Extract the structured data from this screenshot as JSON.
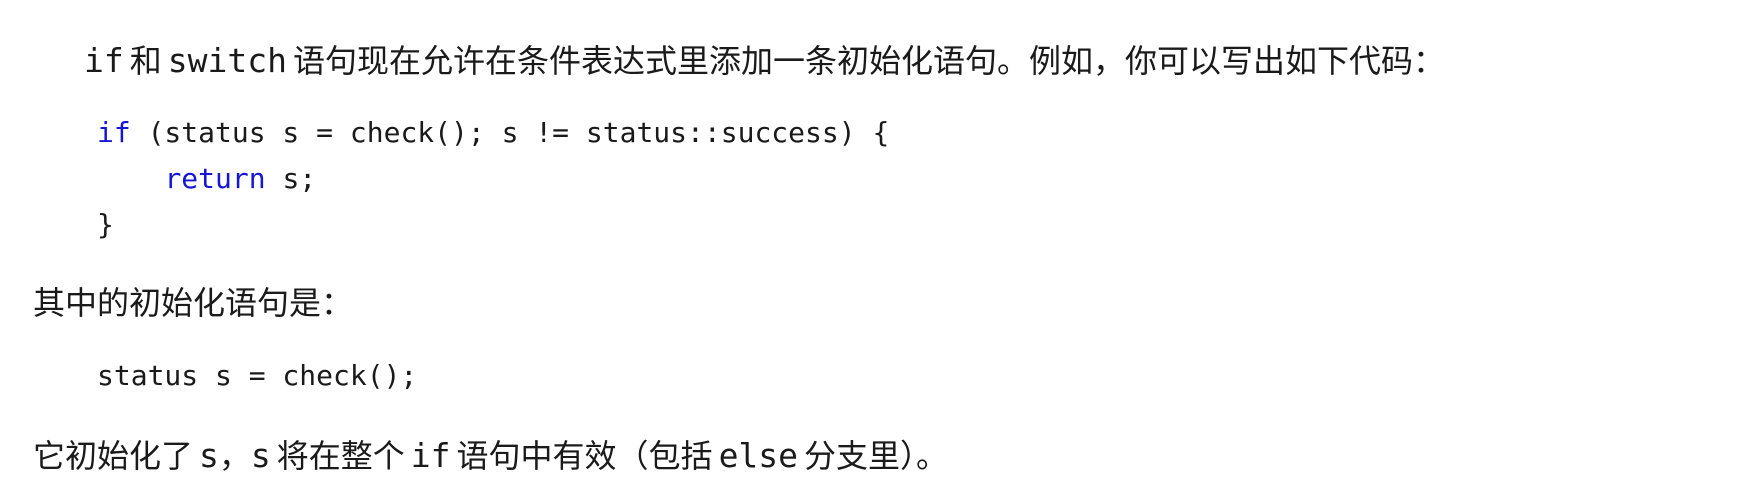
{
  "intro": {
    "kw_if": "if",
    "text_he": "和",
    "kw_switch": "switch",
    "text_rest": "语句现在允许在条件表达式里添加一条初始化语句。例如，你可以写出如下代码："
  },
  "code_block": {
    "line1_kw": "if",
    "line1_rest": " (status s = check(); s != status::success) {",
    "line2_indent": "    ",
    "line2_kw": "return",
    "line2_rest": " s;",
    "line3": "}"
  },
  "init_intro": {
    "text": "其中的初始化语句是："
  },
  "init_code": {
    "line": "status s = check();"
  },
  "conclusion": {
    "text_a": "它初始化了",
    "var_s1": "s",
    "comma": "，",
    "var_s2": "s",
    "text_b": "将在整个",
    "kw_if": "if",
    "text_c": "语句中有效（包括",
    "kw_else": "else",
    "text_d": "分支里）。"
  }
}
